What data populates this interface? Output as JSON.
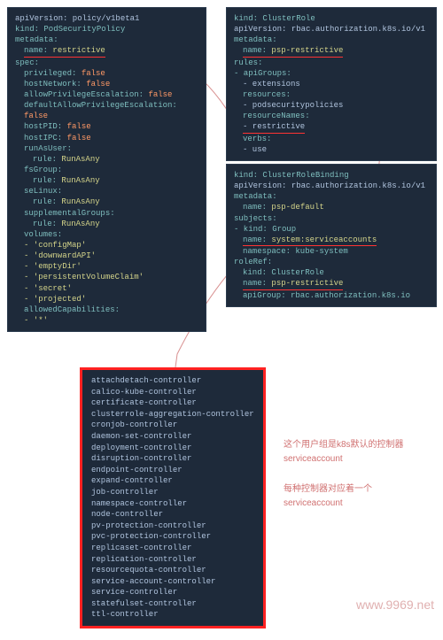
{
  "psp": {
    "l1": "apiVersion: policy/v1beta1",
    "l2": "kind: PodSecurityPolicy",
    "l3": "metadata:",
    "l4a": "name:",
    "l4b": "restrictive",
    "l5": "spec:",
    "l6a": "privileged:",
    "l6b": "false",
    "l7a": "hostNetwork:",
    "l7b": "false",
    "l8a": "allowPrivilegeEscalation:",
    "l8b": "false",
    "l9a": "defaultAllowPrivilegeEscalation:",
    "l9b": "false",
    "l10a": "hostPID:",
    "l10b": "false",
    "l11a": "hostIPC:",
    "l11b": "false",
    "l12": "runAsUser:",
    "l13a": "rule:",
    "l13b": "RunAsAny",
    "l14": "fsGroup:",
    "l15a": "rule:",
    "l15b": "RunAsAny",
    "l16": "seLinux:",
    "l17a": "rule:",
    "l17b": "RunAsAny",
    "l18": "supplementalGroups:",
    "l19a": "rule:",
    "l19b": "RunAsAny",
    "l20": "volumes:",
    "v1": "- 'configMap'",
    "v2": "- 'downwardAPI'",
    "v3": "- 'emptyDir'",
    "v4": "- 'persistentVolumeClaim'",
    "v5": "- 'secret'",
    "v6": "- 'projected'",
    "l21": "allowedCapabilities:",
    "l22": "- '*'"
  },
  "cr": {
    "l1": "kind: ClusterRole",
    "l2": "apiVersion: rbac.authorization.k8s.io/v1",
    "l3": "metadata:",
    "l4a": "name:",
    "l4b": "psp-restrictive",
    "l5": "rules:",
    "l6": "- apiGroups:",
    "l7": "- extensions",
    "l8": "resources:",
    "l9": "- podsecuritypolicies",
    "l10": "resourceNames:",
    "l11": "- restrictive",
    "l12": "verbs:",
    "l13": "- use"
  },
  "crb": {
    "l1": "kind: ClusterRoleBinding",
    "l2": "apiVersion: rbac.authorization.k8s.io/v1",
    "l3": "metadata:",
    "l4a": "name:",
    "l4b": "psp-default",
    "l5": "subjects:",
    "l6": "- kind: Group",
    "l7a": "name:",
    "l7b": "system:serviceaccounts",
    "l8": "namespace: kube-system",
    "l9": "roleRef:",
    "l10": "kind: ClusterRole",
    "l11a": "name:",
    "l11b": "psp-restrictive",
    "l12": "apiGroup: rbac.authorization.k8s.io"
  },
  "sa": {
    "items": [
      "attachdetach-controller",
      "calico-kube-controller",
      "certificate-controller",
      "clusterrole-aggregation-controller",
      "cronjob-controller",
      "daemon-set-controller",
      "deployment-controller",
      "disruption-controller",
      "endpoint-controller",
      "expand-controller",
      "job-controller",
      "namespace-controller",
      "node-controller",
      "pv-protection-controller",
      "pvc-protection-controller",
      "replicaset-controller",
      "replication-controller",
      "resourcequota-controller",
      "service-account-controller",
      "service-controller",
      "statefulset-controller",
      "ttl-controller"
    ]
  },
  "notes": {
    "n1": "这个用户组是k8s默认的控制器 serviceaccount",
    "n2": "每种控制器对应着一个 serviceaccount"
  },
  "watermark": "www.9969.net"
}
